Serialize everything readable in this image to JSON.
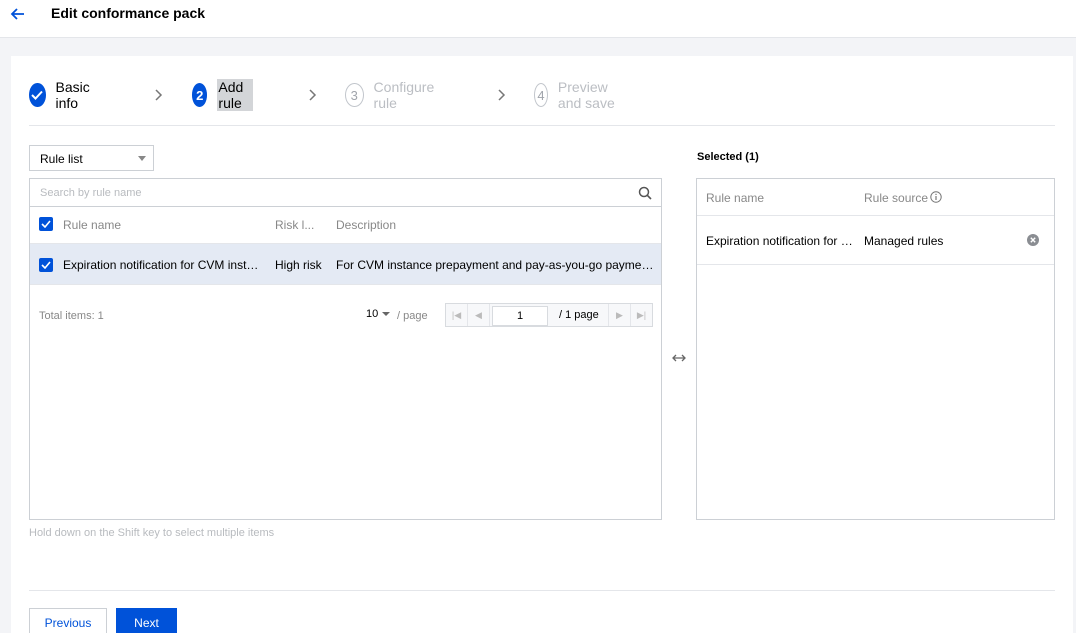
{
  "header": {
    "title": "Edit conformance pack"
  },
  "steps": [
    {
      "label": "Basic info",
      "state": "done"
    },
    {
      "number": "2",
      "label": "Add rule",
      "state": "current"
    },
    {
      "number": "3",
      "label": "Configure rule",
      "state": "todo"
    },
    {
      "number": "4",
      "label": "Preview and save",
      "state": "todo"
    }
  ],
  "rule_select": {
    "value": "Rule list"
  },
  "search": {
    "placeholder": "Search by rule name"
  },
  "rule_table": {
    "columns": [
      "Rule name",
      "Risk l...",
      "Description"
    ],
    "rows": [
      {
        "name": "Expiration notification for CVM instanc...",
        "risk": "High risk",
        "description": "For CVM instance prepayment and pay-as-you-go payment, if t..."
      }
    ]
  },
  "pagination": {
    "total_label": "Total items:  1",
    "page_size": "10",
    "per_page_label": "/ page",
    "current_page": "1",
    "total_pages_label": "/ 1 page"
  },
  "selected": {
    "title": "Selected (1)",
    "columns": [
      "Rule name",
      "Rule source"
    ],
    "rows": [
      {
        "name": "Expiration notification for C...",
        "source": "Managed rules"
      }
    ]
  },
  "hint": "Hold down on the Shift key to select multiple items",
  "buttons": {
    "previous": "Previous",
    "next": "Next"
  },
  "colors": {
    "primary": "#0052d9",
    "row_selected": "#e4eaf4",
    "border": "#ccd0d5"
  }
}
